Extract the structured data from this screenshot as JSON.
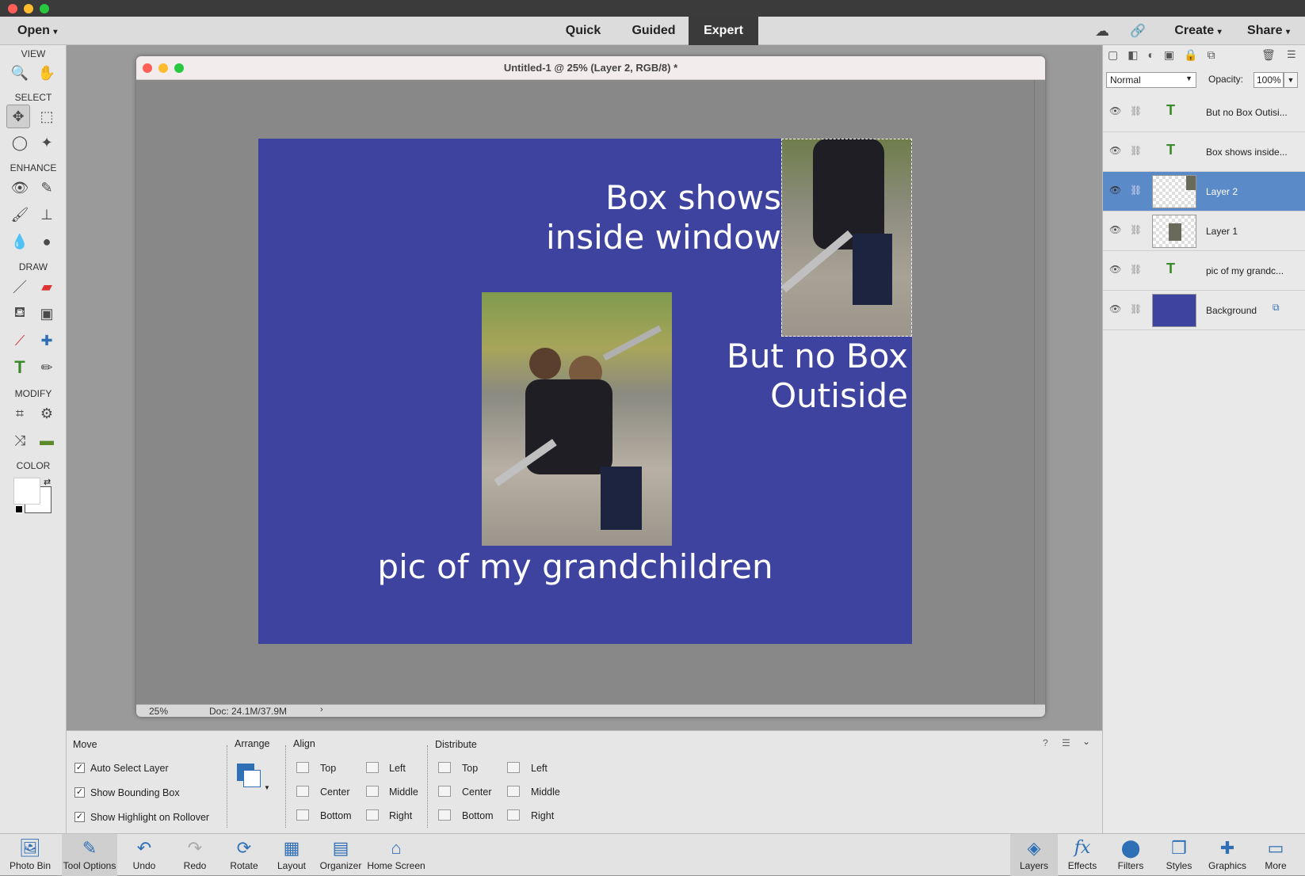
{
  "menu": {
    "open": "Open",
    "quick": "Quick",
    "guided": "Guided",
    "expert": "Expert",
    "create": "Create",
    "share": "Share"
  },
  "toolbox": {
    "view": "VIEW",
    "select": "SELECT",
    "enhance": "ENHANCE",
    "draw": "DRAW",
    "modify": "MODIFY",
    "color": "COLOR"
  },
  "document": {
    "title": "Untitled-1 @ 25% (Layer 2, RGB/8) *",
    "zoom": "25%",
    "doc_size": "Doc: 24.1M/37.9M",
    "background_color": "#3e43a0",
    "text1": "Box shows\ninside window",
    "text2": "But no Box\nOutiside",
    "text3": "pic of my grandchildren"
  },
  "layers_panel": {
    "blend_mode": "Normal",
    "opacity_label": "Opacity:",
    "opacity_value": "100%",
    "layers": [
      {
        "name": "But no Box Outisi...",
        "type": "text"
      },
      {
        "name": "Box shows inside...",
        "type": "text"
      },
      {
        "name": "Layer 2",
        "type": "image",
        "selected": true
      },
      {
        "name": "Layer 1",
        "type": "image"
      },
      {
        "name": "pic of my grandc...",
        "type": "text"
      },
      {
        "name": "Background",
        "type": "fill"
      }
    ]
  },
  "tool_options": {
    "move": "Move",
    "auto_select": "Auto Select Layer",
    "show_bbox": "Show Bounding Box",
    "show_highlight": "Show Highlight on Rollover",
    "arrange": "Arrange",
    "align": "Align",
    "distribute": "Distribute",
    "align_items": [
      "Top",
      "Center",
      "Bottom",
      "Left",
      "Middle",
      "Right"
    ],
    "distribute_items": [
      "Top",
      "Center",
      "Bottom",
      "Left",
      "Middle",
      "Right"
    ]
  },
  "bottom_bar": {
    "left": [
      "Photo Bin",
      "Tool Options",
      "Undo",
      "Redo",
      "Rotate",
      "Layout",
      "Organizer",
      "Home Screen"
    ],
    "right": [
      "Layers",
      "Effects",
      "Filters",
      "Styles",
      "Graphics",
      "More"
    ]
  }
}
